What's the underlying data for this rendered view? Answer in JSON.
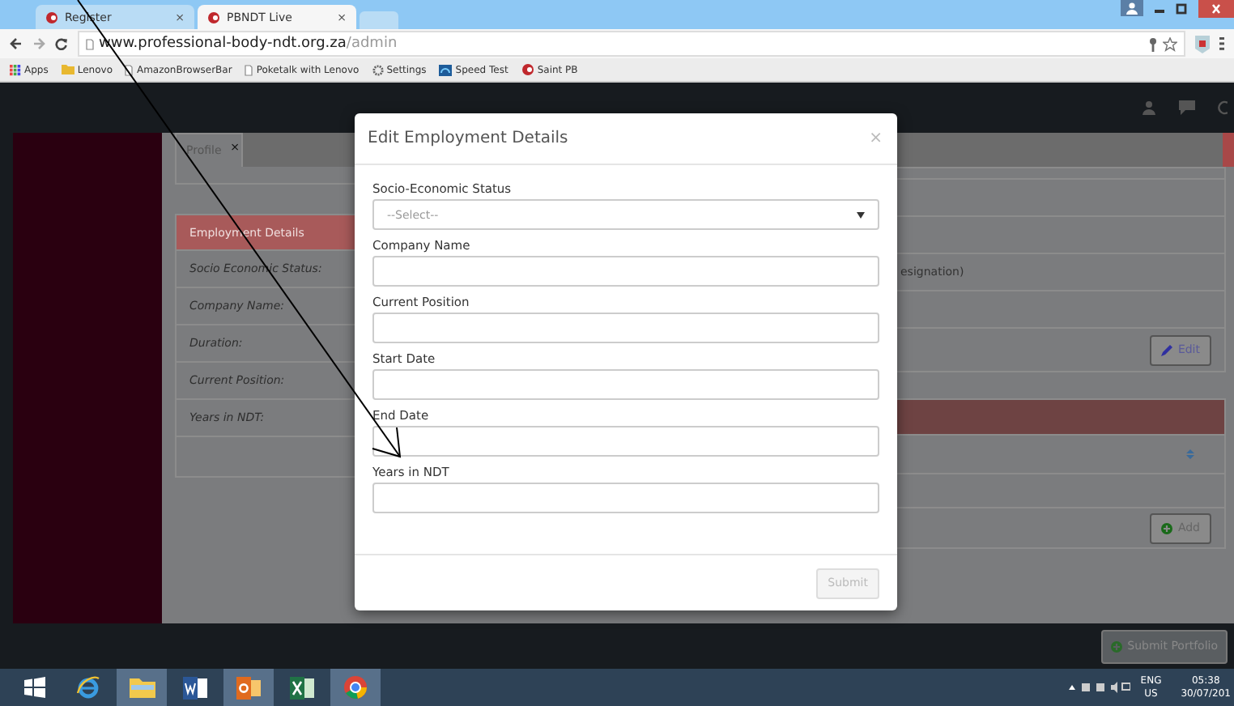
{
  "browser": {
    "tabs": [
      {
        "title": "Register",
        "close": "×",
        "selected": false
      },
      {
        "title": "PBNDT Live",
        "close": "×",
        "selected": true
      }
    ],
    "url": {
      "host": "www.professional-body-ndt.org.za",
      "path": "/admin"
    },
    "bookmarks": [
      {
        "label": "Apps",
        "kind": "apps"
      },
      {
        "label": "Lenovo",
        "kind": "folder"
      },
      {
        "label": "AmazonBrowserBar",
        "kind": "page"
      },
      {
        "label": "Poketalk with Lenovo",
        "kind": "page"
      },
      {
        "label": "Settings",
        "kind": "gear"
      },
      {
        "label": "Speed Test",
        "kind": "speed"
      },
      {
        "label": "Saint PB",
        "kind": "site"
      }
    ]
  },
  "profile_tab": {
    "label": "Profile",
    "close": "×"
  },
  "employment_card": {
    "title": "Employment Details",
    "fields": [
      "Socio Economic Status:",
      "Company Name:",
      "Duration:",
      "Current Position:",
      "Years in NDT:"
    ]
  },
  "detail_card": {
    "row_text": "esignation)",
    "edit_button": "Edit"
  },
  "list_card": {
    "add_button": "Add"
  },
  "footer": {
    "submit_button": "Submit Portfolio"
  },
  "modal": {
    "title": "Edit Employment Details",
    "close": "×",
    "fields": [
      {
        "label": "Socio-Economic Status",
        "kind": "select",
        "value": "--Select--"
      },
      {
        "label": "Company Name",
        "kind": "text"
      },
      {
        "label": "Current Position",
        "kind": "text"
      },
      {
        "label": "Start Date",
        "kind": "text"
      },
      {
        "label": "End Date",
        "kind": "text"
      },
      {
        "label": "Years in NDT",
        "kind": "text"
      }
    ],
    "submit": {
      "label": "Submit",
      "disabled": true
    }
  },
  "taskbar": {
    "apps": [
      {
        "kind": "windows",
        "open": false
      },
      {
        "kind": "browser-e",
        "open": false
      },
      {
        "kind": "folder",
        "open": true
      },
      {
        "kind": "word",
        "open": false
      },
      {
        "kind": "outlook",
        "open": true
      },
      {
        "kind": "excel",
        "open": false
      },
      {
        "kind": "chrome",
        "open": true
      }
    ],
    "language": "ENG",
    "region": "US",
    "time": "05:38",
    "date": "30/07/201"
  }
}
